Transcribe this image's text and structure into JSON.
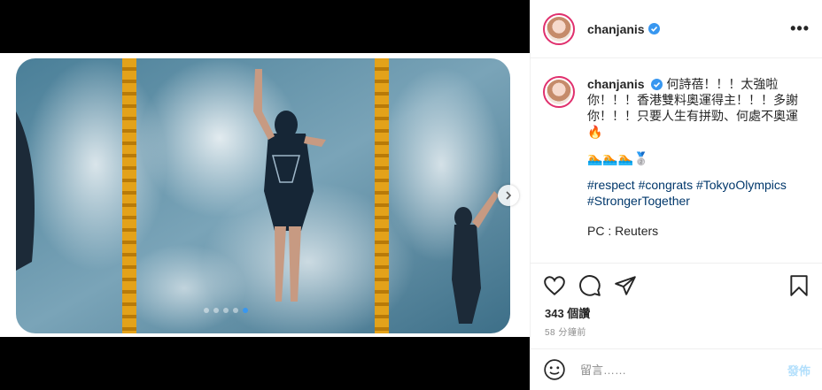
{
  "post": {
    "username": "chanjanis",
    "verified": true,
    "more_icon": "more-horizontal-icon",
    "caption": {
      "line1": "何詩蓓！！！太強啦",
      "line2": "你！！！香港雙料奧運得主！！！多謝",
      "line3": "你！！！只要人生有拼勁、何處不奧運",
      "fire_emoji": "🔥",
      "emoji_row": "🏊🏊🏊🥈",
      "hashtags_line1": "#respect #congrats #TokyoOlympics",
      "hashtags_line2": "#StrongerTogether",
      "credit": "PC : Reuters"
    },
    "likes": "343 個讚",
    "timestamp": "58 分鐘前",
    "comment": {
      "placeholder": "留言……",
      "post_label": "發佈"
    },
    "carousel": {
      "slides": 5,
      "active_slide": 5
    },
    "colors": {
      "accent": "#3897f0",
      "hashtag": "#00376b",
      "post_disabled": "#b2dffc"
    }
  }
}
